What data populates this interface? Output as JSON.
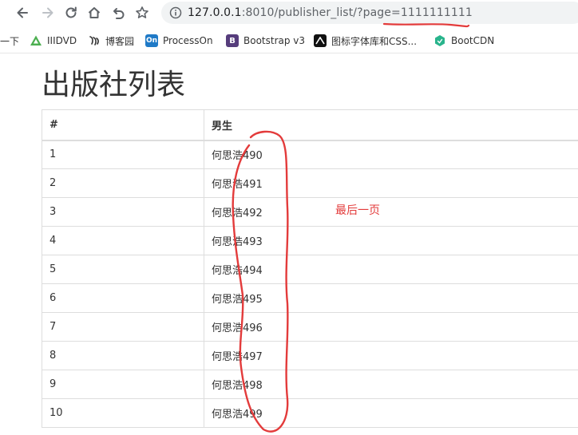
{
  "browser": {
    "url_host": "127.0.0.1",
    "url_rest": ":8010/publisher_list/?page=1111111111",
    "bookmarks": [
      {
        "label": "一下",
        "icon": "none"
      },
      {
        "label": "IIIDVD",
        "icon": "triangle-logo-icon"
      },
      {
        "label": "博客园",
        "icon": "cnblogs-icon"
      },
      {
        "label": "ProcessOn",
        "icon": "processon-icon"
      },
      {
        "label": "Bootstrap v3",
        "icon": "bootstrap-icon"
      },
      {
        "label": "图标字体库和CSS...",
        "icon": "font-icon"
      },
      {
        "label": "BootCDN",
        "icon": "bootcdn-icon"
      }
    ],
    "icons": {
      "processon_badge": "On",
      "bootstrap_badge": "B"
    }
  },
  "page": {
    "title": "出版社列表",
    "table": {
      "headers": [
        "#",
        "男生"
      ],
      "rows": [
        [
          "1",
          "何思浩490"
        ],
        [
          "2",
          "何思浩491"
        ],
        [
          "3",
          "何思浩492"
        ],
        [
          "4",
          "何思浩493"
        ],
        [
          "5",
          "何思浩494"
        ],
        [
          "6",
          "何思浩495"
        ],
        [
          "7",
          "何思浩496"
        ],
        [
          "8",
          "何思浩497"
        ],
        [
          "9",
          "何思浩498"
        ],
        [
          "10",
          "何思浩499"
        ]
      ]
    },
    "annotation": "最后一页"
  },
  "colors": {
    "annotation_red": "#e33b3b",
    "border": "#dddddd",
    "text": "#333333"
  }
}
